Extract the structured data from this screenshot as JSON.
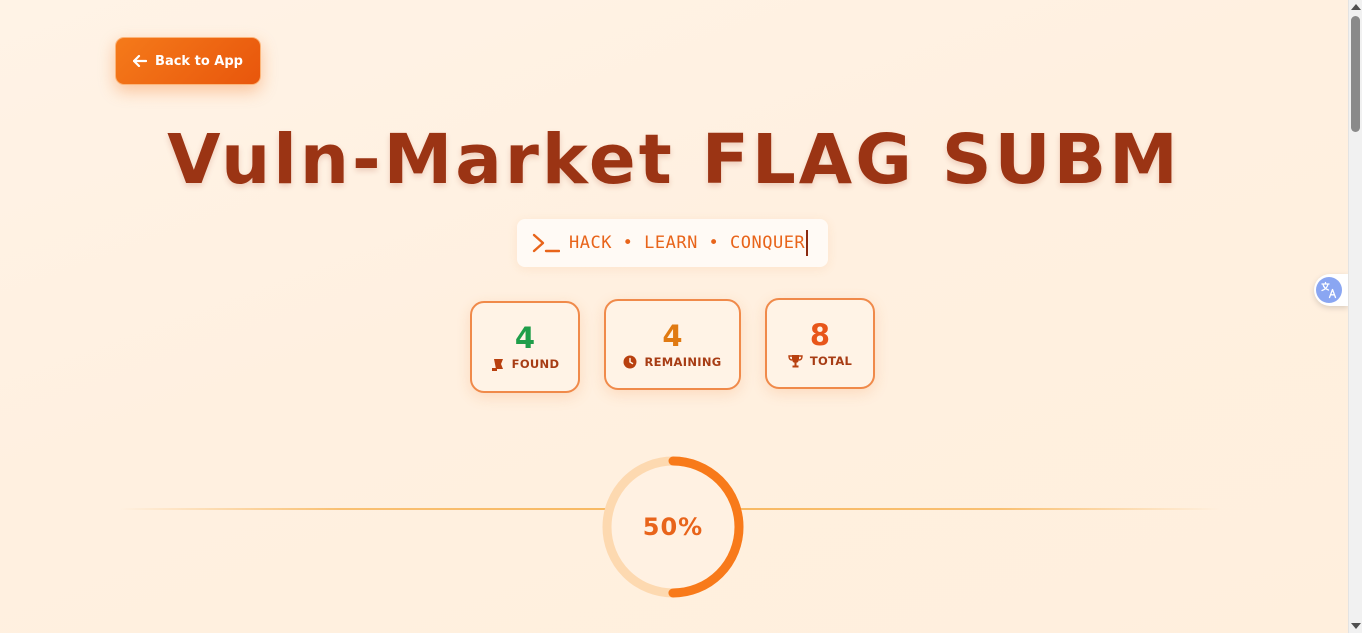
{
  "back_button": {
    "label": "Back to App",
    "icon": "arrow-left-icon"
  },
  "page_title": "Vuln-Market FLAG SUBM",
  "tagline": {
    "prompt_icon": "terminal-prompt-icon",
    "text": "HACK • LEARN • CONQUER"
  },
  "stats": {
    "found": {
      "value": "4",
      "label": "FOUND",
      "icon": "flag-icon",
      "color": "#1f9e4a"
    },
    "remaining": {
      "value": "4",
      "label": "REMAINING",
      "icon": "clock-icon",
      "color": "#e07a12"
    },
    "total": {
      "value": "8",
      "label": "TOTAL",
      "icon": "trophy-icon",
      "color": "#e8561a"
    }
  },
  "progress": {
    "percent_label": "50%",
    "fraction": 0.5,
    "track_color": "#fdd9b0",
    "fill_color": "#f87a1a"
  },
  "translate_button": {
    "icon": "translate-icon"
  },
  "colors": {
    "accent": "#f0701a",
    "title": "#9b3414",
    "background": "#fff1e2"
  }
}
